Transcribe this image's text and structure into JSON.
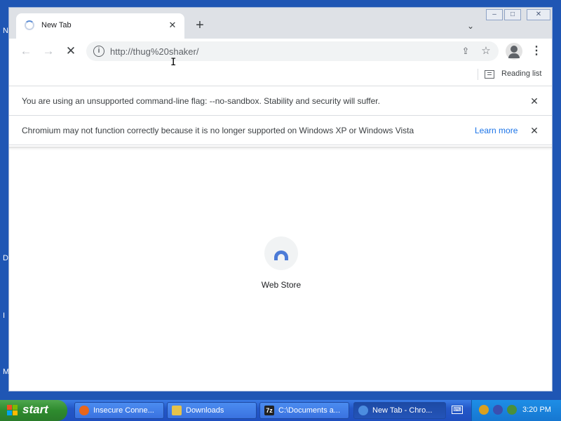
{
  "desktop": {
    "edge_letters": [
      "N",
      "D",
      "I",
      "M"
    ]
  },
  "browser": {
    "tab": {
      "title": "New Tab",
      "close_glyph": "✕"
    },
    "new_tab_glyph": "+",
    "tab_search_glyph": "⌄",
    "window_controls": {
      "minimize": "‒",
      "maximize": "□",
      "close": "✕"
    },
    "nav": {
      "back": "←",
      "forward": "→",
      "stop": "✕"
    },
    "omnibox": {
      "info_glyph": "i",
      "url": "http://thug%20shaker/",
      "share_glyph": "⇪",
      "star_glyph": "☆"
    },
    "menu_glyph": "⋮",
    "reading_list": {
      "label": "Reading list"
    },
    "infobars": [
      {
        "text": "You are using an unsupported command-line flag: --no-sandbox. Stability and security will suffer.",
        "close_glyph": "✕"
      },
      {
        "text": "Chromium may not function correctly because it is no longer supported on Windows XP or Windows Vista",
        "link": "Learn more",
        "close_glyph": "✕"
      }
    ],
    "shortcut": {
      "label": "Web Store",
      "icon": "web-store-icon"
    },
    "cursor_glyph": "I"
  },
  "taskbar": {
    "start_label": "start",
    "tasks": [
      {
        "label": "Insecure Conne...",
        "icon": "firefox-icon",
        "icon_color": "#e8661c"
      },
      {
        "label": "Downloads",
        "icon": "folder-icon",
        "icon_color": "#e6c24a"
      },
      {
        "label": "C:\\Documents a...",
        "icon": "7zip-icon",
        "icon_color": "#222222",
        "icon_text": "7z"
      },
      {
        "label": "New Tab - Chro...",
        "icon": "chromium-icon",
        "icon_color": "#4c8de0"
      }
    ],
    "keyboard_glyph": "⌨",
    "clock": "3:20 PM",
    "tray_icons": [
      "shield-icon",
      "network-icon",
      "sound-icon"
    ]
  }
}
